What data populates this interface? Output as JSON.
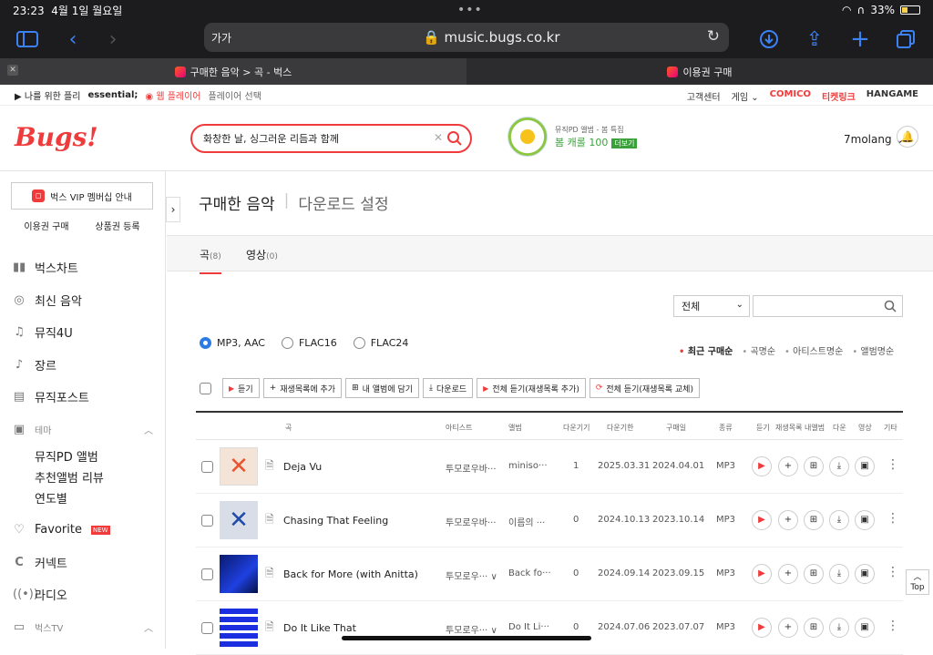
{
  "status": {
    "time": "23:23",
    "date": "4월 1일 월요일",
    "battery": "33%"
  },
  "browser": {
    "aa": "가가",
    "url": "music.bugs.co.kr",
    "tabs": [
      "구매한 음악 > 곡 - 벅스",
      "이용권 구매"
    ]
  },
  "gnb": {
    "left": [
      "나를 위한 플리",
      "essential;",
      "웹 플레이어",
      "플레이어 선택"
    ],
    "right": [
      "고객센터",
      "게임",
      "COMICO",
      "티켓링크",
      "HANGAME"
    ]
  },
  "header": {
    "logo": "Bugs!",
    "search_value": "화창한 날, 싱그러운 리듬과 함께",
    "banner_small": "뮤직PD 앨범 - 봄 특집",
    "banner_big": "봄 캐롤 100",
    "banner_more": "더보기",
    "user": "7molang"
  },
  "sidebar": {
    "vip": "벅스 VIP 멤버십 안내",
    "subs": [
      "이용권 구매",
      "상품권 등록"
    ],
    "items": [
      {
        "label": "벅스차트",
        "icon": "chart-icon"
      },
      {
        "label": "최신 음악",
        "icon": "disc-icon"
      },
      {
        "label": "뮤직4U",
        "icon": "music-note-icon"
      },
      {
        "label": "장르",
        "icon": "guitar-icon"
      },
      {
        "label": "뮤직포스트",
        "icon": "post-icon"
      }
    ],
    "theme_section": "테마",
    "theme_items": [
      "뮤직PD 앨범",
      "추천앨범 리뷰",
      "연도별"
    ],
    "items2": [
      {
        "label": "Favorite",
        "icon": "heart-icon",
        "badge": "NEW"
      },
      {
        "label": "커넥트",
        "icon": "connect-icon"
      },
      {
        "label": "라디오",
        "icon": "radio-icon"
      }
    ],
    "tv_section": "벅스TV"
  },
  "main": {
    "title": "구매한 음악",
    "title2": "다운로드 설정",
    "tabs": [
      {
        "label": "곡",
        "count": "(8)"
      },
      {
        "label": "영상",
        "count": "(0)"
      }
    ],
    "filter_select": "전체",
    "formats": [
      "MP3, AAC",
      "FLAC16",
      "FLAC24"
    ],
    "sorts": [
      "최근 구매순",
      "곡명순",
      "아티스트명순",
      "앨범명순"
    ],
    "actions": [
      "듣기",
      "재생목록에 추가",
      "내 앨범에 담기",
      "다운로드",
      "전체 듣기(재생목록 추가)",
      "전체 듣기(재생목록 교체)"
    ],
    "columns": [
      "곡",
      "아티스트",
      "앨범",
      "다운기기",
      "다운기한",
      "구매일",
      "종류",
      "듣기",
      "재생목록",
      "내앨범",
      "다운",
      "영상",
      "기타"
    ],
    "rows": [
      {
        "title": "Deja Vu",
        "artist": "투모로우바···",
        "album": "miniso···",
        "devices": "1",
        "expire": "2025.03.31",
        "purchased": "2024.04.01",
        "format": "MP3"
      },
      {
        "title": "Chasing That Feeling",
        "artist": "투모로우바···",
        "album": "이름의 ···",
        "devices": "0",
        "expire": "2024.10.13",
        "purchased": "2023.10.14",
        "format": "MP3"
      },
      {
        "title": "Back for More (with Anitta)",
        "artist": "투모로우··· ∨",
        "album": "Back fo···",
        "devices": "0",
        "expire": "2024.09.14",
        "purchased": "2023.09.15",
        "format": "MP3"
      },
      {
        "title": "Do It Like That",
        "artist": "투모로우··· ∨",
        "album": "Do It Li···",
        "devices": "0",
        "expire": "2024.07.06",
        "purchased": "2023.07.07",
        "format": "MP3"
      }
    ]
  },
  "top_button": "Top"
}
